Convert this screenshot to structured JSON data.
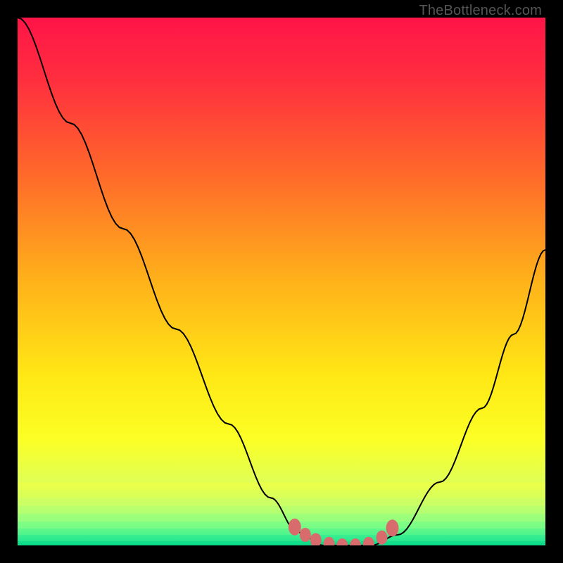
{
  "watermark": "TheBottleneck.com",
  "colors": {
    "black": "#000000",
    "curve": "#000000",
    "marker": "#d86b6b",
    "gradient": [
      {
        "stop": 0.0,
        "color": "#ff1448"
      },
      {
        "stop": 0.12,
        "color": "#ff2f3e"
      },
      {
        "stop": 0.3,
        "color": "#ff6a2a"
      },
      {
        "stop": 0.5,
        "color": "#ffb21a"
      },
      {
        "stop": 0.68,
        "color": "#ffe815"
      },
      {
        "stop": 0.8,
        "color": "#fbff25"
      },
      {
        "stop": 0.88,
        "color": "#e0ff55"
      },
      {
        "stop": 0.93,
        "color": "#b8ff70"
      },
      {
        "stop": 0.965,
        "color": "#7cff85"
      },
      {
        "stop": 0.985,
        "color": "#35f091"
      },
      {
        "stop": 1.0,
        "color": "#00d789"
      }
    ]
  },
  "chart_data": {
    "type": "line",
    "title": "",
    "xlabel": "",
    "ylabel": "",
    "x": [
      0.0,
      0.1,
      0.2,
      0.3,
      0.4,
      0.48,
      0.53,
      0.58,
      0.63,
      0.67,
      0.72,
      0.8,
      0.88,
      0.94,
      1.0
    ],
    "values": [
      1.0,
      0.8,
      0.6,
      0.41,
      0.23,
      0.09,
      0.025,
      0.0,
      0.0,
      0.0,
      0.02,
      0.12,
      0.26,
      0.4,
      0.56
    ],
    "xlim": [
      0,
      1
    ],
    "ylim": [
      0,
      1
    ],
    "markers": {
      "x": [
        0.525,
        0.545,
        0.565,
        0.59,
        0.615,
        0.64,
        0.665,
        0.69,
        0.71
      ],
      "y": [
        0.035,
        0.02,
        0.01,
        0.003,
        0.0,
        0.0,
        0.003,
        0.015,
        0.033
      ]
    }
  }
}
